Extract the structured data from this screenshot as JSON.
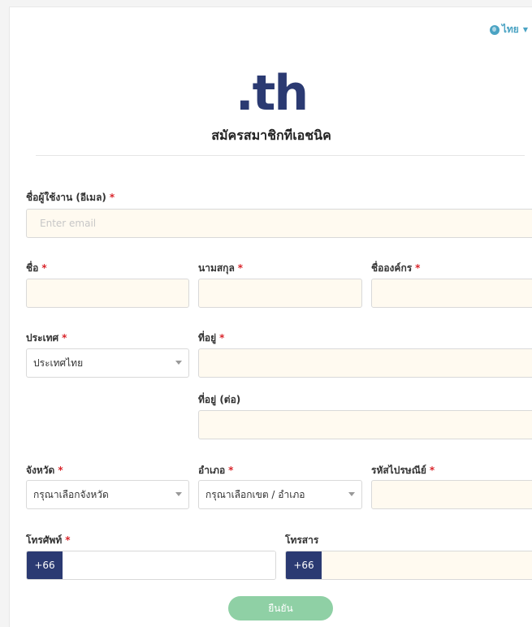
{
  "language": {
    "label": "ไทย"
  },
  "header": {
    "logo_text": ".th",
    "title": "สมัครสมาชิกทีเอชนิค"
  },
  "form": {
    "email": {
      "label": "ชื่อผู้ใช้งาน (อีเมล)",
      "placeholder": "Enter email",
      "value": ""
    },
    "first_name": {
      "label": "ชื่อ",
      "value": ""
    },
    "last_name": {
      "label": "นามสกุล",
      "value": ""
    },
    "organization": {
      "label": "ชื่อองค์กร",
      "value": ""
    },
    "country": {
      "label": "ประเทศ",
      "selected": "ประเทศไทย"
    },
    "address": {
      "label": "ที่อยู่",
      "value": ""
    },
    "address2": {
      "label": "ที่อยู่ (ต่อ)",
      "value": ""
    },
    "province": {
      "label": "จังหวัด",
      "selected": "กรุณาเลือกจังหวัด"
    },
    "district": {
      "label": "อำเภอ",
      "selected": "กรุณาเลือกเขต / อำเภอ"
    },
    "postcode": {
      "label": "รหัสไปรษณีย์",
      "value": ""
    },
    "phone": {
      "label": "โทรศัพท์",
      "prefix": "+66",
      "value": ""
    },
    "fax": {
      "label": "โทรสาร",
      "prefix": "+66",
      "value": ""
    },
    "required_mark": "*",
    "submit_label": "ยืนยัน"
  },
  "colors": {
    "brand": "#2b3a72",
    "accent": "#4aa3c3",
    "submit": "#8fd0a5",
    "required": "#d9252b",
    "field_bg": "#fffaf0"
  }
}
